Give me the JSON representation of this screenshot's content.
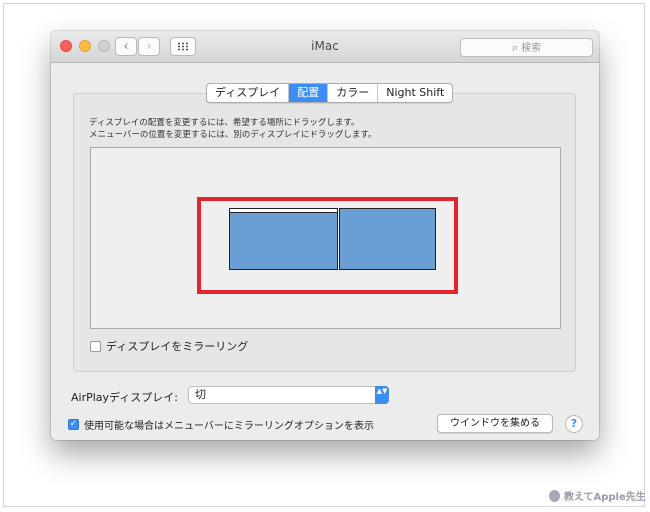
{
  "window": {
    "title": "iMac"
  },
  "toolbar": {
    "back_glyph": "‹",
    "forward_glyph": "›",
    "search_placeholder": "検索",
    "search_glyph": "⌕"
  },
  "tabs": [
    {
      "label": "ディスプレイ",
      "active": false
    },
    {
      "label": "配置",
      "active": true
    },
    {
      "label": "カラー",
      "active": false
    },
    {
      "label": "Night Shift",
      "active": false
    }
  ],
  "arrangement": {
    "instruction_line1": "ディスプレイの配置を変更するには、希望する場所にドラッグします。",
    "instruction_line2": "メニューバーの位置を変更するには、別のディスプレイにドラッグします。"
  },
  "mirror": {
    "label": "ディスプレイをミラーリング",
    "checked": false
  },
  "airplay": {
    "label": "AirPlayディスプレイ:",
    "value": "切",
    "arrow_glyph": "▲▼"
  },
  "show_option": {
    "label": "使用可能な場合はメニューバーにミラーリングオプションを表示",
    "checked": true,
    "check_glyph": "✓"
  },
  "gather_button": {
    "label": "ウインドウを集める"
  },
  "help_button": {
    "label": "?"
  },
  "watermark": {
    "text": "教えてApple先生"
  },
  "colors": {
    "accent": "#3c8ef5",
    "display_fill": "#6a9fd5",
    "highlight": "#e3262e"
  }
}
